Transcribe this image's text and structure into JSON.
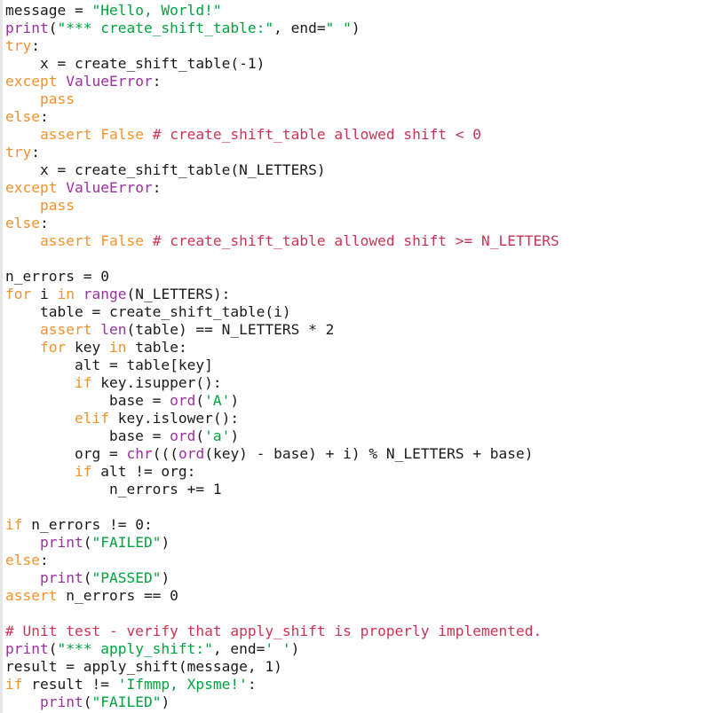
{
  "editor": {
    "language": "Python",
    "background_color": "#ffffff",
    "gutter_color": "#e6e6e6",
    "font_size_px": 16,
    "line_height_px": 20,
    "tab_size": 4
  },
  "theme": {
    "plain": "#1a1a1a",
    "keyword": "#f2922d",
    "builtin": "#9b30a0",
    "exception": "#9b30a0",
    "string": "#00a33f",
    "comment": "#cc3355",
    "number": "#1a1a1a"
  },
  "code": {
    "lines": [
      [
        {
          "t": "plain",
          "s": "message = "
        },
        {
          "t": "string",
          "s": "\"Hello, World!\""
        }
      ],
      [
        {
          "t": "builtin",
          "s": "print"
        },
        {
          "t": "plain",
          "s": "("
        },
        {
          "t": "string",
          "s": "\"*** create_shift_table:\""
        },
        {
          "t": "plain",
          "s": ", end="
        },
        {
          "t": "string",
          "s": "\" \""
        },
        {
          "t": "plain",
          "s": ")"
        }
      ],
      [
        {
          "t": "keyword",
          "s": "try"
        },
        {
          "t": "plain",
          "s": ":"
        }
      ],
      [
        {
          "t": "plain",
          "s": "    x = create_shift_table(-1)"
        }
      ],
      [
        {
          "t": "keyword",
          "s": "except"
        },
        {
          "t": "plain",
          "s": " "
        },
        {
          "t": "exc",
          "s": "ValueError"
        },
        {
          "t": "plain",
          "s": ":"
        }
      ],
      [
        {
          "t": "plain",
          "s": "    "
        },
        {
          "t": "keyword",
          "s": "pass"
        }
      ],
      [
        {
          "t": "keyword",
          "s": "else"
        },
        {
          "t": "plain",
          "s": ":"
        }
      ],
      [
        {
          "t": "plain",
          "s": "    "
        },
        {
          "t": "keyword",
          "s": "assert"
        },
        {
          "t": "plain",
          "s": " "
        },
        {
          "t": "keyword",
          "s": "False"
        },
        {
          "t": "plain",
          "s": " "
        },
        {
          "t": "comment",
          "s": "# create_shift_table allowed shift < 0"
        }
      ],
      [
        {
          "t": "keyword",
          "s": "try"
        },
        {
          "t": "plain",
          "s": ":"
        }
      ],
      [
        {
          "t": "plain",
          "s": "    x = create_shift_table(N_LETTERS)"
        }
      ],
      [
        {
          "t": "keyword",
          "s": "except"
        },
        {
          "t": "plain",
          "s": " "
        },
        {
          "t": "exc",
          "s": "ValueError"
        },
        {
          "t": "plain",
          "s": ":"
        }
      ],
      [
        {
          "t": "plain",
          "s": "    "
        },
        {
          "t": "keyword",
          "s": "pass"
        }
      ],
      [
        {
          "t": "keyword",
          "s": "else"
        },
        {
          "t": "plain",
          "s": ":"
        }
      ],
      [
        {
          "t": "plain",
          "s": "    "
        },
        {
          "t": "keyword",
          "s": "assert"
        },
        {
          "t": "plain",
          "s": " "
        },
        {
          "t": "keyword",
          "s": "False"
        },
        {
          "t": "plain",
          "s": " "
        },
        {
          "t": "comment",
          "s": "# create_shift_table allowed shift >= N_LETTERS"
        }
      ],
      [
        {
          "t": "plain",
          "s": ""
        }
      ],
      [
        {
          "t": "plain",
          "s": "n_errors = 0"
        }
      ],
      [
        {
          "t": "keyword",
          "s": "for"
        },
        {
          "t": "plain",
          "s": " i "
        },
        {
          "t": "keyword",
          "s": "in"
        },
        {
          "t": "plain",
          "s": " "
        },
        {
          "t": "builtin",
          "s": "range"
        },
        {
          "t": "plain",
          "s": "(N_LETTERS):"
        }
      ],
      [
        {
          "t": "plain",
          "s": "    table = create_shift_table(i)"
        }
      ],
      [
        {
          "t": "plain",
          "s": "    "
        },
        {
          "t": "keyword",
          "s": "assert"
        },
        {
          "t": "plain",
          "s": " "
        },
        {
          "t": "builtin",
          "s": "len"
        },
        {
          "t": "plain",
          "s": "(table) == N_LETTERS * 2"
        }
      ],
      [
        {
          "t": "plain",
          "s": "    "
        },
        {
          "t": "keyword",
          "s": "for"
        },
        {
          "t": "plain",
          "s": " key "
        },
        {
          "t": "keyword",
          "s": "in"
        },
        {
          "t": "plain",
          "s": " table:"
        }
      ],
      [
        {
          "t": "plain",
          "s": "        alt = table[key]"
        }
      ],
      [
        {
          "t": "plain",
          "s": "        "
        },
        {
          "t": "keyword",
          "s": "if"
        },
        {
          "t": "plain",
          "s": " key.isupper():"
        }
      ],
      [
        {
          "t": "plain",
          "s": "            base = "
        },
        {
          "t": "builtin",
          "s": "ord"
        },
        {
          "t": "plain",
          "s": "("
        },
        {
          "t": "string",
          "s": "'A'"
        },
        {
          "t": "plain",
          "s": ")"
        }
      ],
      [
        {
          "t": "plain",
          "s": "        "
        },
        {
          "t": "keyword",
          "s": "elif"
        },
        {
          "t": "plain",
          "s": " key.islower():"
        }
      ],
      [
        {
          "t": "plain",
          "s": "            base = "
        },
        {
          "t": "builtin",
          "s": "ord"
        },
        {
          "t": "plain",
          "s": "("
        },
        {
          "t": "string",
          "s": "'a'"
        },
        {
          "t": "plain",
          "s": ")"
        }
      ],
      [
        {
          "t": "plain",
          "s": "        org = "
        },
        {
          "t": "builtin",
          "s": "chr"
        },
        {
          "t": "plain",
          "s": "((("
        },
        {
          "t": "builtin",
          "s": "ord"
        },
        {
          "t": "plain",
          "s": "(key) - base) + i) % N_LETTERS + base)"
        }
      ],
      [
        {
          "t": "plain",
          "s": "        "
        },
        {
          "t": "keyword",
          "s": "if"
        },
        {
          "t": "plain",
          "s": " alt != org:"
        }
      ],
      [
        {
          "t": "plain",
          "s": "            n_errors += 1"
        }
      ],
      [
        {
          "t": "plain",
          "s": ""
        }
      ],
      [
        {
          "t": "keyword",
          "s": "if"
        },
        {
          "t": "plain",
          "s": " n_errors != 0:"
        }
      ],
      [
        {
          "t": "plain",
          "s": "    "
        },
        {
          "t": "builtin",
          "s": "print"
        },
        {
          "t": "plain",
          "s": "("
        },
        {
          "t": "string",
          "s": "\"FAILED\""
        },
        {
          "t": "plain",
          "s": ")"
        }
      ],
      [
        {
          "t": "keyword",
          "s": "else"
        },
        {
          "t": "plain",
          "s": ":"
        }
      ],
      [
        {
          "t": "plain",
          "s": "    "
        },
        {
          "t": "builtin",
          "s": "print"
        },
        {
          "t": "plain",
          "s": "("
        },
        {
          "t": "string",
          "s": "\"PASSED\""
        },
        {
          "t": "plain",
          "s": ")"
        }
      ],
      [
        {
          "t": "keyword",
          "s": "assert"
        },
        {
          "t": "plain",
          "s": " n_errors == 0"
        }
      ],
      [
        {
          "t": "plain",
          "s": ""
        }
      ],
      [
        {
          "t": "comment",
          "s": "# Unit test - verify that apply_shift is properly implemented."
        }
      ],
      [
        {
          "t": "builtin",
          "s": "print"
        },
        {
          "t": "plain",
          "s": "("
        },
        {
          "t": "string",
          "s": "\"*** apply_shift:\""
        },
        {
          "t": "plain",
          "s": ", end="
        },
        {
          "t": "string",
          "s": "' '"
        },
        {
          "t": "plain",
          "s": ")"
        }
      ],
      [
        {
          "t": "plain",
          "s": "result = apply_shift(message, 1)"
        }
      ],
      [
        {
          "t": "keyword",
          "s": "if"
        },
        {
          "t": "plain",
          "s": " result != "
        },
        {
          "t": "string",
          "s": "'Ifmmp, Xpsme!'"
        },
        {
          "t": "plain",
          "s": ":"
        }
      ],
      [
        {
          "t": "plain",
          "s": "    "
        },
        {
          "t": "builtin",
          "s": "print"
        },
        {
          "t": "plain",
          "s": "("
        },
        {
          "t": "string",
          "s": "\"FAILED\""
        },
        {
          "t": "plain",
          "s": ")"
        }
      ]
    ]
  }
}
